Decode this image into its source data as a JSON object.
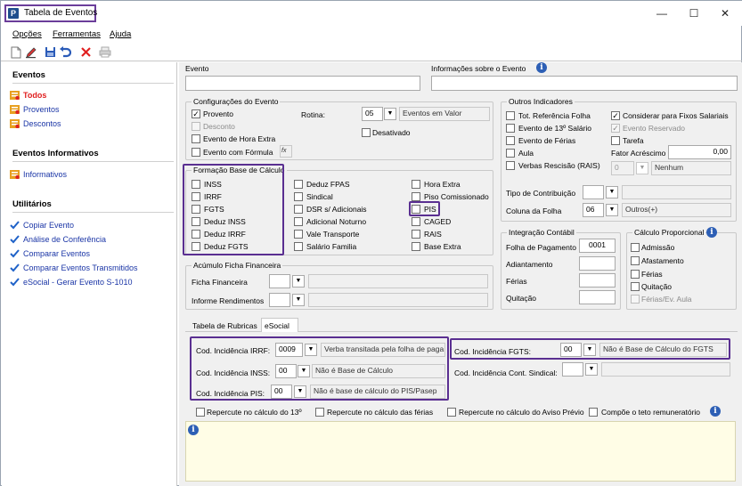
{
  "window": {
    "title": "Tabela de Eventos",
    "controls": {
      "minimize": "—",
      "maximize": "☐",
      "close": "✕"
    }
  },
  "menu": {
    "items": [
      "Opções",
      "Ferramentas",
      "Ajuda"
    ]
  },
  "toolbar": {
    "icons": [
      "new-icon",
      "edit-icon",
      "save-icon",
      "undo-icon",
      "delete-icon",
      "print-icon"
    ]
  },
  "sidebar": {
    "sections": {
      "eventos": {
        "title": "Eventos",
        "items": [
          "Todos",
          "Proventos",
          "Descontos"
        ]
      },
      "informativos": {
        "title": "Eventos Informativos",
        "items": [
          "Informativos"
        ]
      },
      "utilitarios": {
        "title": "Utilitários",
        "items": [
          "Copiar Evento",
          "Análise de Conferência",
          "Comparar Eventos",
          "Comparar Eventos Transmitidos",
          "eSocial - Gerar Evento S-1010"
        ]
      }
    }
  },
  "header": {
    "evento_label": "Evento",
    "info_label": "Informações sobre o Evento",
    "evento_value": "",
    "info_value": ""
  },
  "config": {
    "title": "Configurações do Evento",
    "provento": "Provento",
    "desconto": "Desconto",
    "hora_extra": "Evento de Hora Extra",
    "com_formula": "Evento com Fórmula",
    "formula_btn": "fx",
    "rotina_label": "Rotina:",
    "rotina_code": "05",
    "rotina_desc": "Eventos em Valor",
    "desativado": "Desativado"
  },
  "formacao": {
    "title": "Formação Base de Cálculo",
    "col1": [
      "INSS",
      "IRRF",
      "FGTS",
      "Deduz INSS",
      "Deduz IRRF",
      "Deduz FGTS"
    ],
    "col2": [
      "Deduz FPAS",
      "Sindical",
      "DSR s/ Adicionais",
      "Adicional Noturno",
      "Vale Transporte",
      "Salário Familia"
    ],
    "col3": [
      "Hora Extra",
      "Piso Comissionado",
      "PIS",
      "CAGED",
      "RAIS",
      "Base Extra"
    ]
  },
  "acumulo": {
    "title": "Acúmulo Ficha Financeira",
    "ficha_label": "Ficha Financeira",
    "informe_label": "Informe Rendimentos"
  },
  "outros": {
    "title": "Outros Indicadores",
    "tot_ref": "Tot. Referência Folha",
    "evento_13": "Evento de 13º Salário",
    "evento_ferias": "Evento de Férias",
    "aula": "Aula",
    "verbas": "Verbas Rescisão (RAIS)",
    "considerar": "Considerar para Fixos Salariais",
    "reservado": "Evento Reservado",
    "tarefa": "Tarefa",
    "fator_label": "Fator Acréscimo",
    "fator_value": "0,00",
    "nenhum_code": "0",
    "nenhum_desc": "Nenhum",
    "tipo_contrib_label": "Tipo de Contribuição",
    "coluna_label": "Coluna da Folha",
    "coluna_code": "06",
    "coluna_desc": "Outros(+)"
  },
  "integracao": {
    "title": "Integração Contábil",
    "folha_label": "Folha de Pagamento",
    "folha_value": "0001",
    "adiant_label": "Adiantamento",
    "ferias_label": "Férias",
    "quitacao_label": "Quitação"
  },
  "proporcional": {
    "title": "Cálculo Proporcional",
    "items": [
      "Admissão",
      "Afastamento",
      "Férias",
      "Quitação",
      "Férias/Ev. Aula"
    ]
  },
  "tabs": {
    "rubricas": "Tabela de Rubricas",
    "esocial": "eSocial"
  },
  "esocial": {
    "irrf_label": "Cod. Incidência IRRF:",
    "irrf_code": "0009",
    "irrf_desc": "Verba transitada pela folha de paga",
    "inss_label": "Cod. Incidência INSS:",
    "inss_code": "00",
    "inss_desc": "Não é Base de Cálculo",
    "pis_label": "Cod. Incidência PIS:",
    "pis_code": "00",
    "pis_desc": "Não é base de cálculo do PIS/Pasep",
    "fgts_label": "Cod. Incidência FGTS:",
    "fgts_code": "00",
    "fgts_desc": "Não é Base de Cálculo do FGTS",
    "sindical_label": "Cod. Incidência Cont. Sindical:",
    "sindical_code": "",
    "sindical_desc": ""
  },
  "repercute": {
    "r13": "Repercute no cálculo do 13º",
    "ferias": "Repercute no cálculo das férias",
    "aviso": "Repercute no cálculo do Aviso Prévio",
    "teto": "Compõe o teto remuneratório"
  }
}
